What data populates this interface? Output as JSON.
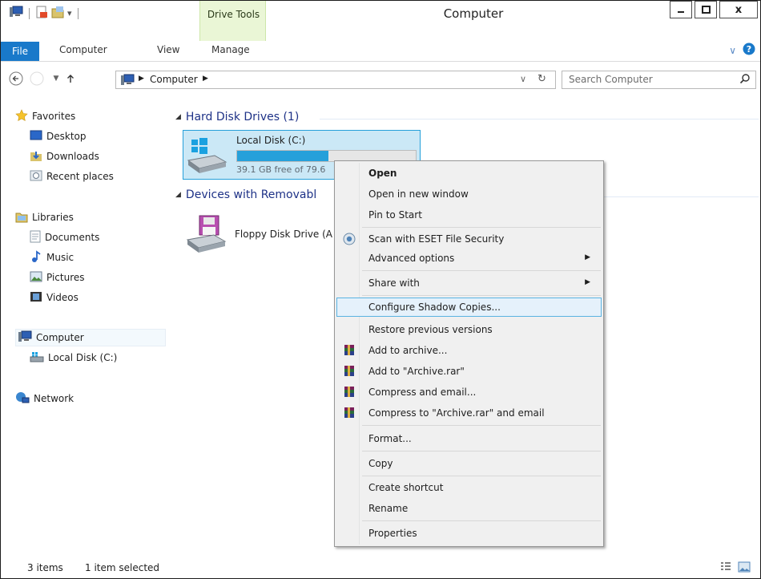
{
  "window": {
    "title": "Computer"
  },
  "ribbon": {
    "contextual_tab": "Drive Tools",
    "tabs": [
      "File",
      "Computer",
      "View",
      "Manage"
    ]
  },
  "address": {
    "crumb": "Computer",
    "search_placeholder": "Search Computer"
  },
  "nav": {
    "favorites": "Favorites",
    "desktop": "Desktop",
    "downloads": "Downloads",
    "recent": "Recent places",
    "libraries": "Libraries",
    "documents": "Documents",
    "music": "Music",
    "pictures": "Pictures",
    "videos": "Videos",
    "computer": "Computer",
    "local_disk": "Local Disk (C:)",
    "network": "Network"
  },
  "content": {
    "hdd_group": "Hard Disk Drives (1)",
    "local_disk_name": "Local Disk (C:)",
    "local_disk_free": "39.1 GB free of 79.6",
    "local_disk_used_fraction": 0.51,
    "removable_group": "Devices with Removabl",
    "floppy_name": "Floppy Disk Drive (A"
  },
  "context_menu": {
    "open": "Open",
    "open_new_window": "Open in new window",
    "pin_to_start": "Pin to Start",
    "scan_eset": "Scan with ESET File Security",
    "advanced_options": "Advanced options",
    "share_with": "Share with",
    "configure_shadow": "Configure Shadow Copies...",
    "restore_previous": "Restore previous versions",
    "add_to_archive": "Add to archive...",
    "add_to_archive_rar": "Add to \"Archive.rar\"",
    "compress_email": "Compress and email...",
    "compress_rar_email": "Compress to \"Archive.rar\" and email",
    "format": "Format...",
    "copy": "Copy",
    "create_shortcut": "Create shortcut",
    "rename": "Rename",
    "properties": "Properties"
  },
  "status": {
    "items": "3 items",
    "selected": "1 item selected"
  },
  "colors": {
    "accent": "#1979ca",
    "selection": "#cbe8f6",
    "selection_border": "#26a0da",
    "link_blue": "#1e3287"
  }
}
